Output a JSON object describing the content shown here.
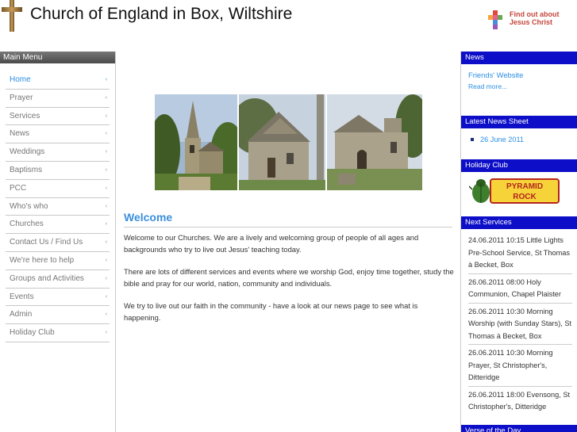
{
  "header": {
    "site_title": "Church of England in Box, Wiltshire",
    "find_out_line1": "Find out about",
    "find_out_line2": "Jesus Christ"
  },
  "menu": {
    "title": "Main Menu",
    "items": [
      {
        "label": "Home",
        "arrow": "‹"
      },
      {
        "label": "Prayer",
        "arrow": "‹"
      },
      {
        "label": "Services",
        "arrow": "‹"
      },
      {
        "label": "News",
        "arrow": "‹"
      },
      {
        "label": "Weddings",
        "arrow": "‹"
      },
      {
        "label": "Baptisms",
        "arrow": "‹"
      },
      {
        "label": "PCC",
        "arrow": "‹"
      },
      {
        "label": "Who's who",
        "arrow": "‹"
      },
      {
        "label": "Churches",
        "arrow": "‹"
      },
      {
        "label": "Contact Us / Find Us",
        "arrow": "‹"
      },
      {
        "label": "We're here to help",
        "arrow": "‹"
      },
      {
        "label": "Groups and Activities",
        "arrow": "‹"
      },
      {
        "label": "Events",
        "arrow": "‹"
      },
      {
        "label": "Admin",
        "arrow": "‹"
      },
      {
        "label": "Holiday Club",
        "arrow": "‹"
      }
    ]
  },
  "main": {
    "welcome_title": "Welcome",
    "para1": "Welcome to our Churches. We are a lively and welcoming group of people of all ages and backgrounds who try to live out Jesus' teaching today.",
    "para2": "There are lots of different services and events where we worship God, enjoy time together, study the bible and pray for our world, nation, community and individuals.",
    "para3": "We try to live out our faith in the community - have a look at our news page to see what is happening."
  },
  "right": {
    "news_title": "News",
    "news_link": "Friends' Website",
    "read_more": "Read more...",
    "latest_title": "Latest News Sheet",
    "latest_item": "26 June 2011",
    "holiday_title": "Holiday Club",
    "holiday_logo_line1": "PYRAMID",
    "holiday_logo_line2": "ROCK",
    "next_title": "Next Services",
    "services": [
      "24.06.2011 10:15 Little Lights Pre-School Service, St Thomas à Becket, Box",
      "26.06.2011 08:00 Holy Communion, Chapel Plaister",
      "26.06.2011 10:30 Morning Worship (with Sunday Stars), St Thomas à Becket, Box",
      "26.06.2011 10:30 Morning Prayer, St Christopher's, Ditteridge",
      "26.06.2011 18:00 Evensong, St Christopher's, Ditteridge"
    ],
    "verse_title": "Verse of the Day"
  }
}
